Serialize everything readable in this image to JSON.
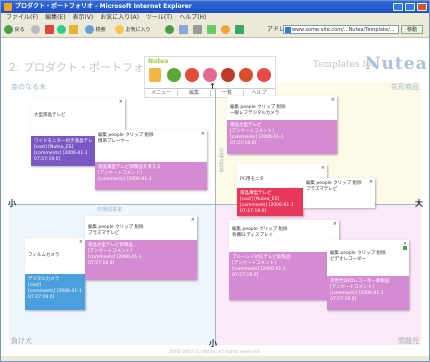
{
  "window": {
    "title": "プロダクト・ポートフォリオ - Microsoft Internet Explorer"
  },
  "menubar": [
    "ファイル(F)",
    "編集(E)",
    "表示(V)",
    "お気に入り(A)",
    "ツール(T)",
    "ヘルプ(H)"
  ],
  "toolbar": {
    "back_label": "戻る",
    "search_label": "検索",
    "favorites_label": "お気に入り",
    "address_label": "アドレス(D)",
    "address_value": "www.some-site.com/...Nutea/Template/...",
    "go_label": "移動"
  },
  "page": {
    "title": "2. プロダクト・ポートフォリオ",
    "templates_for": "Templates for",
    "brand": "Nutea",
    "footer": "2005-2007 (C) Nutea All rights reserved."
  },
  "palette": {
    "brand": "Nutea",
    "tabs": [
      "メニュー",
      "編集",
      "一覧",
      "ヘルプ"
    ]
  },
  "quadrants": {
    "top_left": "金のなる木",
    "top_right": "花形商品",
    "bottom_left": "負け犬",
    "bottom_right": "問題児"
  },
  "axes": {
    "left": "小",
    "right": "大",
    "top": "↑",
    "bottom": "小",
    "center_x": "市場成長率",
    "center_y": "市場占有率"
  },
  "cards": [
    {
      "name": "card-plasma-tv",
      "color": "#ffffff",
      "lines": [
        "大型液晶テレビ"
      ]
    },
    {
      "name": "card-mobile-line",
      "color": "#7a57c5",
      "lines": [
        "ワイドモニター付き液晶テレ",
        "[cost] [Nutea_ES]",
        "[comments] [2006-01-1",
        "07:27:19.0]"
      ]
    },
    {
      "name": "card-portable-player",
      "color": "#ffffff",
      "lines": [
        "編集 people クリップ 削除",
        "携帯プレーヤー"
      ]
    },
    {
      "name": "card-purple-note",
      "color": "#d58bd1",
      "lines": [
        "液晶薄型テレビ新製品を考える",
        "[アンケートコメント]",
        "[comments] [2006-01-1",
        "07:27:19.0]"
      ]
    },
    {
      "name": "card-compact-camera",
      "color": "#ffffff",
      "lines": [
        "編集 people クリップ 削除",
        "一眼レフデジタルカメラ"
      ]
    },
    {
      "name": "card-star-purple",
      "color": "#d58bd1",
      "lines": [
        "液晶大型テレビ",
        "[アンケートコメント]",
        "[comments] [2006-01-1",
        "07:27:19.0]"
      ]
    },
    {
      "name": "card-pc-monitor",
      "color": "#ffffff",
      "lines": [
        "PC用モニタ"
      ]
    },
    {
      "name": "card-red-note",
      "color": "#e8375a",
      "lines": [
        "液晶薄型テレビ",
        "[cost] [Nutea_ES]",
        "[comments] [2006-01-1",
        "07:27:19.0]"
      ]
    },
    {
      "name": "card-lcd-tv",
      "color": "#ffffff",
      "lines": [
        "編集 people クリップ 削除",
        "プラズマテレビ"
      ]
    },
    {
      "name": "card-film-camera",
      "color": "#ffffff",
      "lines": [
        "フィルムカメラ"
      ]
    },
    {
      "name": "card-blue-note",
      "color": "#4a9fdc",
      "lines": [
        "デジタルカメラ",
        "[cost]",
        "[comments] [2006-01-1",
        "07:27:19.0]"
      ]
    },
    {
      "name": "card-dog-purple",
      "color": "#d58bd1",
      "lines": [
        "液晶大型テレビ新製品",
        "[アンケートコメント]",
        "[comments] [2006-01-1",
        "07:27:19.0]"
      ]
    },
    {
      "name": "card-digital-camera",
      "color": "#ffffff",
      "lines": [
        "編集 people クリップ 削除",
        "有機ELディスプレイ"
      ]
    },
    {
      "name": "card-question-purple",
      "color": "#d58bd1",
      "lines": [
        "ブルーレイ対応テレビ新製品",
        "[アンケートコメント]",
        "[comments] [2006-01-1",
        "07:27:19.0]"
      ]
    },
    {
      "name": "card-video-recorder",
      "color": "#ffffff",
      "lines": [
        "編集 people クリップ 削除",
        "ビデオレコーダー"
      ]
    },
    {
      "name": "card-question-purple-2",
      "color": "#d58bd1",
      "lines": [
        "次世代DVDレコーダー新製品",
        "[アンケートコメント]",
        "[comments] [2006-01-1",
        "07:27:19.0]"
      ]
    }
  ],
  "colors": {
    "q_top_left": "#ffffff",
    "q_top_right": "#fdfbe8",
    "q_bottom_left": "#eef6fc",
    "q_bottom_right": "#fbe9f9"
  }
}
